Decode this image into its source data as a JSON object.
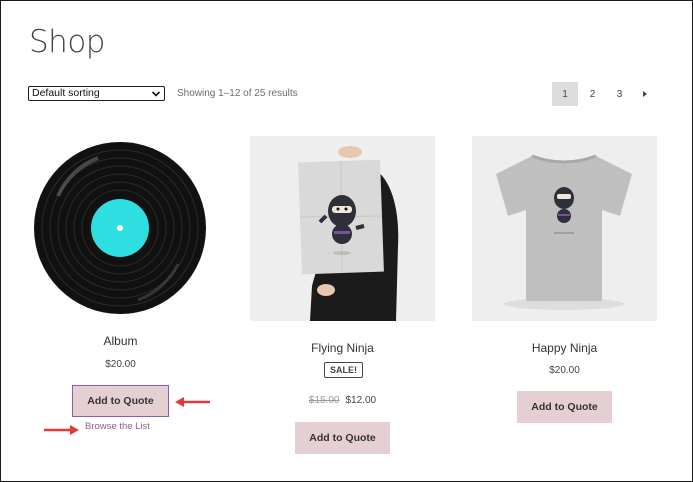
{
  "page": {
    "title": "Shop"
  },
  "toolbar": {
    "sort_selected": "Default sorting",
    "result_count": "Showing 1–12 of 25 results"
  },
  "pagination": {
    "pages": [
      "1",
      "2",
      "3"
    ],
    "current": "1",
    "next_icon": "next-arrow-icon"
  },
  "products": [
    {
      "name": "Album",
      "price": "$20.00",
      "button": "Add to Quote",
      "browse_link": "Browse the List",
      "image": "vinyl-record-icon"
    },
    {
      "name": "Flying Ninja",
      "badge": "SALE!",
      "old_price": "$15.00",
      "price": "$12.00",
      "button": "Add to Quote",
      "image": "ninja-poster-image"
    },
    {
      "name": "Happy Ninja",
      "price": "$20.00",
      "button": "Add to Quote",
      "image": "ninja-tshirt-image"
    }
  ],
  "colors": {
    "button_bg": "#e6cfd2",
    "link": "#96588a",
    "annotation_arrow": "#e03a3a",
    "record_label": "#2ddfe0"
  }
}
